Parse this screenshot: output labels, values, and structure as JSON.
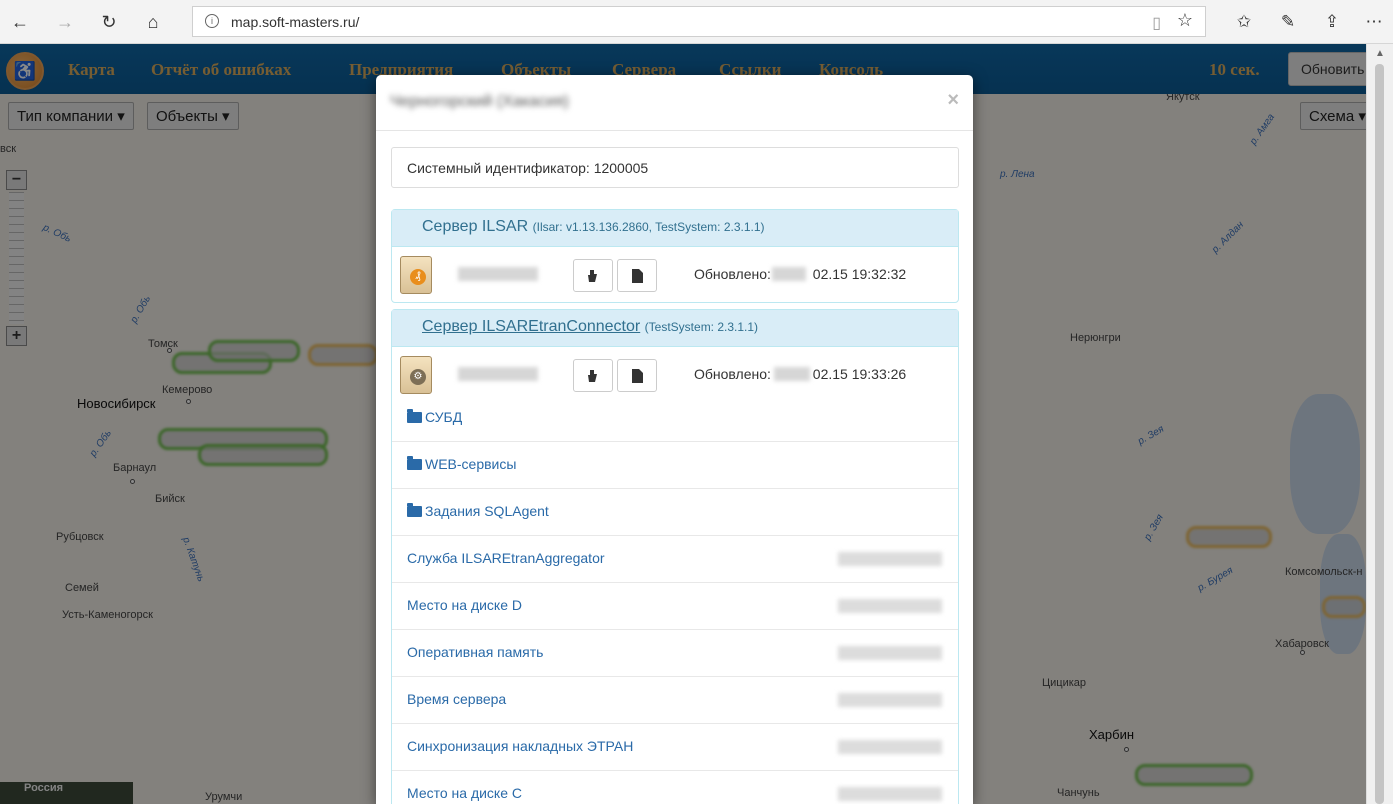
{
  "browser": {
    "url": "map.soft-masters.ru/",
    "icons": [
      "back-icon",
      "forward-icon",
      "refresh-icon",
      "home-icon",
      "info-icon",
      "reading-view-icon",
      "favorite-star-icon",
      "favorites-list-icon",
      "pen-icon",
      "share-icon",
      "more-icon"
    ]
  },
  "appbar": {
    "menu": [
      "Карта",
      "Отчёт об ошибках",
      "Предприятия",
      "Объекты",
      "Сервера",
      "Ссылки",
      "Консоль"
    ],
    "timer": "10 сек.",
    "refresh_label": "Обновить"
  },
  "map": {
    "selects": {
      "company_type": "Тип компании",
      "objects": "Объекты",
      "scheme": "Схема"
    },
    "zoom_in": "+",
    "zoom_out": "−",
    "places": [
      "вск",
      "Томск",
      "Кемерово",
      "Новосибирск",
      "Барнаул",
      "Бийск",
      "Рубцовск",
      "Семей",
      "Усть-Каменогорск",
      "Урумчи",
      "Якутск",
      "Нерюнгри",
      "Комсомольск-н",
      "Хабаровск",
      "Цицикар",
      "Харбин",
      "Чанчунь"
    ],
    "rivers": [
      "р. Обь",
      "р. Обь",
      "р. Обь",
      "р. Катунь",
      "р. Лена",
      "р. Амга",
      "р. Алдан",
      "р. Зея",
      "р. Зея",
      "р. Бурея"
    ],
    "mini_label": "Россия"
  },
  "modal": {
    "title": "Черногорский (Хакасия)",
    "close": "×",
    "system_id": "Системный идентификатор: 1200005",
    "servers": [
      {
        "name": "Сервер ILSAR",
        "version": "(Ilsar: v1.13.136.2860, TestSystem: 2.3.1.1)",
        "updated_label": "Обновлено:",
        "updated_value": "02.15 19:32:32"
      },
      {
        "name": "Сервер ILSAREtranConnector",
        "version": "(TestSystem: 2.3.1.1)",
        "updated_label": "Обновлено:",
        "updated_value": "02.15 19:33:26"
      }
    ],
    "items": [
      {
        "label": "СУБД",
        "folder": true
      },
      {
        "label": "WEB-сервисы",
        "folder": true
      },
      {
        "label": "Задания SQLAgent",
        "folder": true
      },
      {
        "label": "Служба ILSAREtranAggregator",
        "folder": false
      },
      {
        "label": "Место на диске D",
        "folder": false
      },
      {
        "label": "Оперативная память",
        "folder": false
      },
      {
        "label": "Время сервера",
        "folder": false
      },
      {
        "label": "Синхронизация накладных ЭТРАН",
        "folder": false
      },
      {
        "label": "Место на диске C",
        "folder": false
      }
    ]
  }
}
